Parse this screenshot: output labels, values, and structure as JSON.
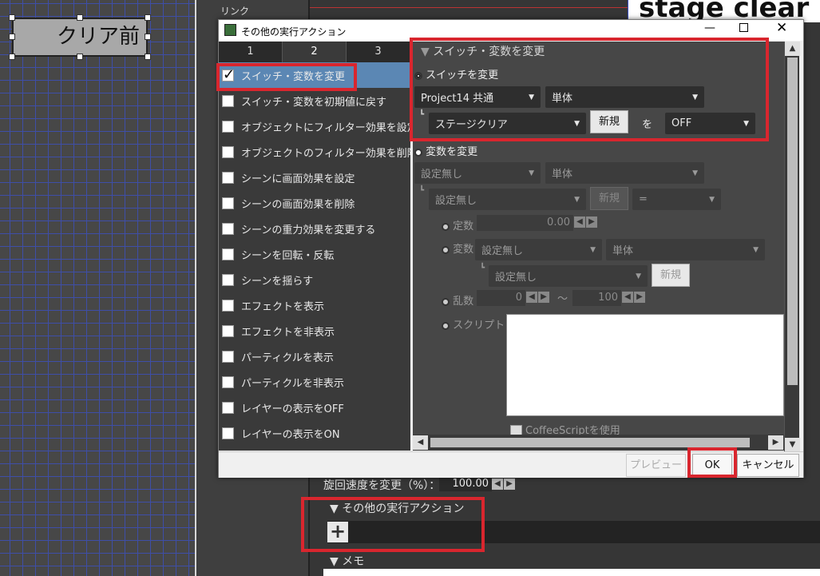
{
  "canvas": {
    "object_label": "クリア前",
    "stage_title": "stage clear",
    "link_label": "リンク"
  },
  "background_props": {
    "rotation_label": "旋回速度を変更（%）：",
    "rotation_value": "100.00",
    "section_other": "その他の実行アクション",
    "section_memo": "メモ"
  },
  "dialog": {
    "title": "その他の実行アクション",
    "tabs": [
      "1",
      "2",
      "3"
    ],
    "list_items": [
      {
        "label": "スイッチ・変数を変更",
        "checked": true,
        "selected": true
      },
      {
        "label": "スイッチ・変数を初期値に戻す",
        "checked": false
      },
      {
        "label": "オブジェクトにフィルター効果を設定",
        "checked": false
      },
      {
        "label": "オブジェクトのフィルター効果を削除",
        "checked": false
      },
      {
        "label": "シーンに画面効果を設定",
        "checked": false
      },
      {
        "label": "シーンの画面効果を削除",
        "checked": false
      },
      {
        "label": "シーンの重力効果を変更する",
        "checked": false
      },
      {
        "label": "シーンを回転・反転",
        "checked": false
      },
      {
        "label": "シーンを揺らす",
        "checked": false
      },
      {
        "label": "エフェクトを表示",
        "checked": false
      },
      {
        "label": "エフェクトを非表示",
        "checked": false
      },
      {
        "label": "パーティクルを表示",
        "checked": false
      },
      {
        "label": "パーティクルを非表示",
        "checked": false
      },
      {
        "label": "レイヤーの表示をOFF",
        "checked": false
      },
      {
        "label": "レイヤーの表示をON",
        "checked": false
      }
    ],
    "panel": {
      "heading": "スイッチ・変数を変更",
      "switch_radio": "スイッチを変更",
      "switch_scope": "Project14 共通",
      "switch_unit": "単体",
      "switch_name": "ステージクリア",
      "new_btn": "新規",
      "wo": "を",
      "switch_value": "OFF",
      "var_radio": "変数を変更",
      "var_scope": "設定無し",
      "var_unit": "単体",
      "var_name": "設定無し",
      "var_new": "新規",
      "var_op": "=",
      "const_label": "定数",
      "const_value": "0.00",
      "varsrc_label": "変数",
      "varsrc_scope": "設定無し",
      "varsrc_unit": "単体",
      "varsrc_name": "設定無し",
      "varsrc_new": "新規",
      "rand_label": "乱数",
      "rand_min": "0",
      "rand_tilde": "～",
      "rand_max": "100",
      "script_label": "スクリプト",
      "coffee_label": "CoffeeScriptを使用"
    },
    "footer": {
      "preview": "プレビュー",
      "ok": "OK",
      "cancel": "キャンセル"
    }
  }
}
